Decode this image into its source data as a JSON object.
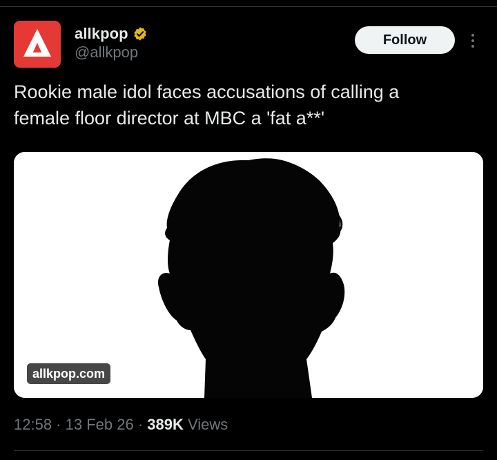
{
  "account": {
    "display_name": "allkpop",
    "handle": "@allkpop",
    "verified": true,
    "avatar_letter": "A"
  },
  "follow_button": {
    "label": "Follow"
  },
  "more_menu": {
    "icon": "more-vertical-icon"
  },
  "tweet": {
    "text": "Rookie male idol faces accusations of calling a\nfemale floor director at MBC a 'fat a**'"
  },
  "media": {
    "link_domain": "allkpop.com",
    "image_subject": "silhouette-placeholder"
  },
  "meta": {
    "time": "12:58",
    "separator_1": " · ",
    "date": "13 Feb 26",
    "separator_2": " · ",
    "views_count": "389K",
    "views_label": " Views"
  },
  "colors": {
    "background": "#000000",
    "text_primary": "#e7e9ea",
    "text_secondary": "#71767b",
    "avatar_red": "#e53935",
    "verified_gold": "#e2b719",
    "follow_bg": "#eff3f4",
    "divider": "#2f3336"
  }
}
